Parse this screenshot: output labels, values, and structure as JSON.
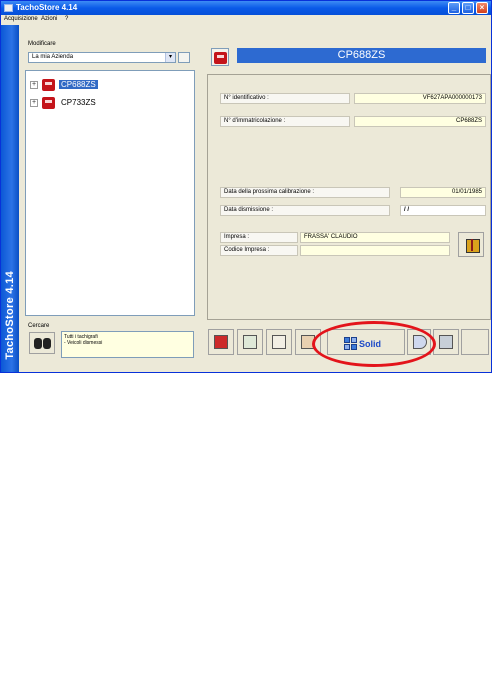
{
  "window": {
    "title": "TachoStore 4.14",
    "controls": [
      "_",
      "□",
      "×"
    ]
  },
  "menu": [
    "Acquisizione",
    "Azioni",
    "?"
  ],
  "sidebar": {
    "brand_text": "TachoStore 4.14"
  },
  "company": {
    "label": "Modificare",
    "selected": "La mia Azienda"
  },
  "tree": {
    "items": [
      {
        "label": "CP688ZS",
        "selected": true
      },
      {
        "label": "CP733ZS",
        "selected": false
      }
    ]
  },
  "search": {
    "label": "Cercare",
    "lines": [
      "Tutti i tachigrafi",
      "- Veicoli dismessi"
    ]
  },
  "vehicle": {
    "header": "CP688ZS",
    "fields": {
      "id_label": "N° identificativo :",
      "id_value": "VF627APA000000173",
      "reg_label": "N° d'immatricolazione :",
      "reg_value": "CP688ZS",
      "calib_label": "Data della prossima calibrazione :",
      "calib_value": "01/01/1985",
      "dism_label": "Data dismissione :",
      "dism_value": "/ /",
      "impresa_label": "Impresa :",
      "impresa_value": "FRASSA' CLAUDIO",
      "code_label": "Codice Impresa :",
      "code_value": ""
    }
  },
  "toolbar": {
    "solid_label": "Solid"
  },
  "colors": {
    "header_bar": "#2d6ad1",
    "highlight_ring": "#e3141b",
    "selection": "#316ac5"
  }
}
